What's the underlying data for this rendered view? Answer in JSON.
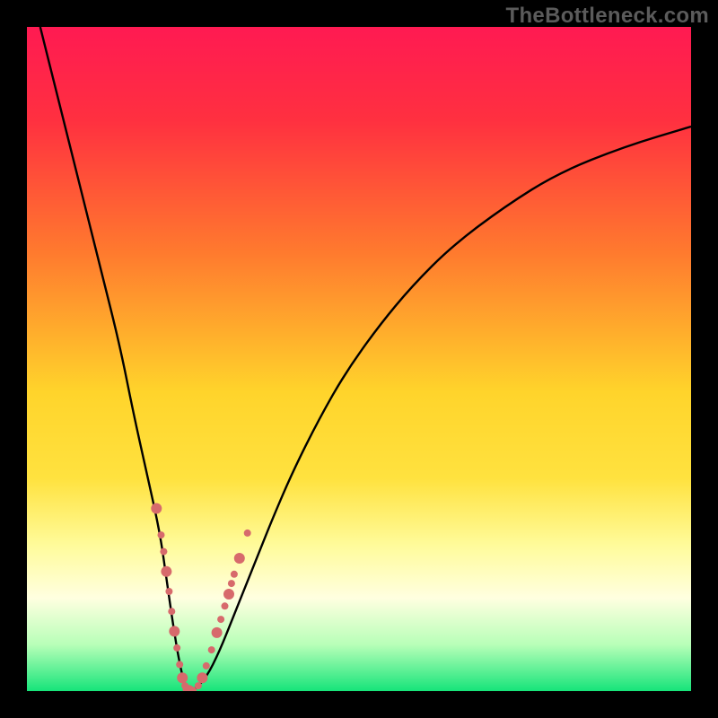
{
  "watermark": "TheBottleneck.com",
  "colors": {
    "frame": "#000000",
    "curve": "#000000",
    "marker": "#d76a6c",
    "gradient_stops": [
      {
        "pct": 0,
        "color": "#ff1a52"
      },
      {
        "pct": 14,
        "color": "#ff3040"
      },
      {
        "pct": 34,
        "color": "#ff7a2e"
      },
      {
        "pct": 55,
        "color": "#ffd42b"
      },
      {
        "pct": 68,
        "color": "#ffe23f"
      },
      {
        "pct": 78,
        "color": "#fffb9a"
      },
      {
        "pct": 86,
        "color": "#ffffe0"
      },
      {
        "pct": 93,
        "color": "#b8ffb8"
      },
      {
        "pct": 100,
        "color": "#16e47a"
      }
    ]
  },
  "chart_data": {
    "type": "line",
    "title": "",
    "xlabel": "",
    "ylabel": "",
    "xlim": [
      0,
      100
    ],
    "ylim": [
      0,
      100
    ],
    "series": [
      {
        "name": "bottleneck-curve",
        "x": [
          2,
          5,
          8,
          11,
          14,
          16,
          18,
          20,
          21,
          22,
          23,
          24,
          25,
          27,
          29,
          31,
          33,
          35,
          37,
          40,
          44,
          48,
          53,
          58,
          64,
          72,
          80,
          90,
          100
        ],
        "y": [
          100,
          88,
          76,
          64,
          52,
          42,
          33,
          24,
          17,
          10,
          4,
          0,
          0,
          2,
          6,
          11,
          16,
          21,
          26,
          33,
          41,
          48,
          55,
          61,
          67,
          73,
          78,
          82,
          85
        ]
      }
    ],
    "markers": {
      "name": "highlighted-points",
      "x": [
        19.5,
        20.2,
        20.6,
        21.0,
        21.4,
        21.8,
        22.2,
        22.6,
        23.0,
        23.4,
        23.8,
        24.0,
        24.4,
        25.0,
        25.8,
        26.4,
        27.0,
        27.8,
        28.6,
        29.2,
        29.8,
        30.4,
        30.8,
        31.2,
        32.0,
        33.2
      ],
      "y": [
        27.5,
        23.5,
        21.0,
        18.0,
        15.0,
        12.0,
        9.0,
        6.5,
        4.0,
        2.0,
        0.8,
        0.2,
        0.1,
        0.1,
        0.8,
        2.0,
        3.8,
        6.2,
        8.8,
        10.8,
        12.8,
        14.6,
        16.2,
        17.6,
        20.0,
        23.8
      ]
    },
    "vertex_x": 24,
    "background": "vertical red→yellow→green gradient (bottleneck heat)"
  }
}
